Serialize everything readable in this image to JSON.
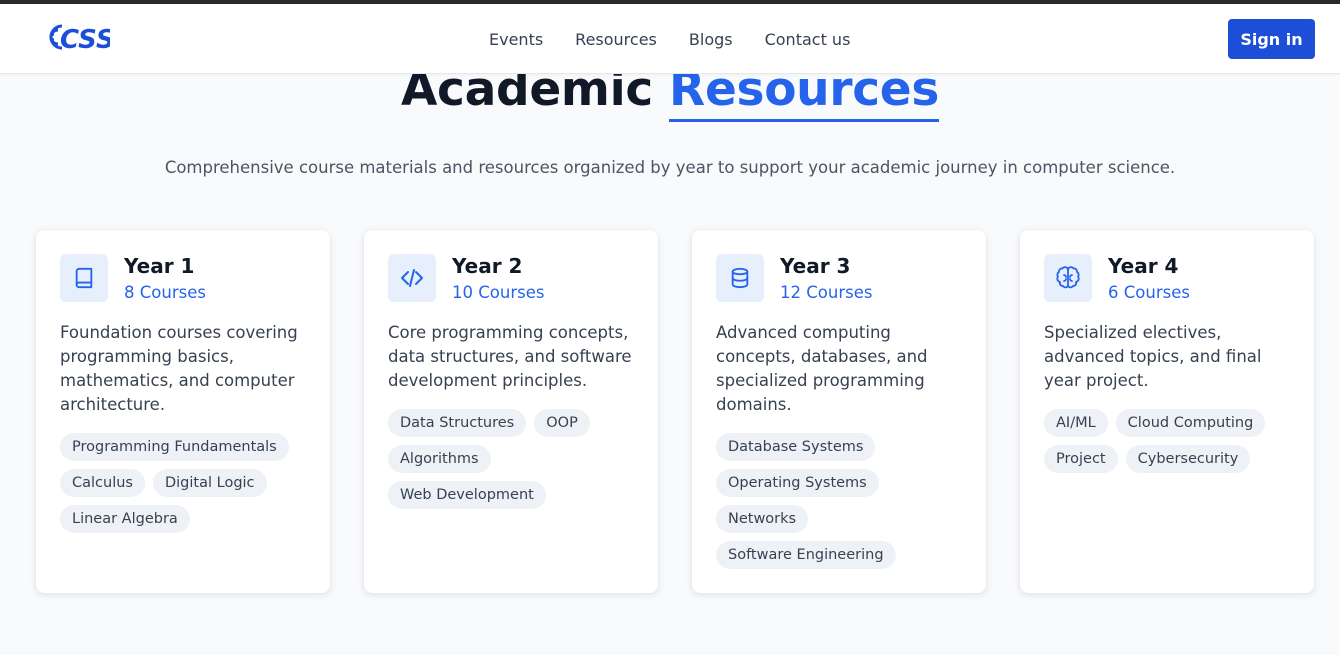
{
  "nav": {
    "logo_text": "CSS",
    "links": [
      "Events",
      "Resources",
      "Blogs",
      "Contact us"
    ],
    "signin_label": "Sign in"
  },
  "hero": {
    "title_main": "Academic",
    "title_accent": "Resources",
    "subtitle": "Comprehensive course materials and resources organized by year to support your academic journey in computer science."
  },
  "colors": {
    "accent": "#2563eb",
    "button": "#1d4ed8",
    "icon_bg": "#e8effc",
    "tag_bg": "#eef2f7"
  },
  "years": [
    {
      "title": "Year 1",
      "count": "8 Courses",
      "icon": "book-icon",
      "description": "Foundation courses covering programming basics, mathematics, and computer architecture.",
      "tags": [
        "Programming Fundamentals",
        "Calculus",
        "Digital Logic",
        "Linear Algebra"
      ]
    },
    {
      "title": "Year 2",
      "count": "10 Courses",
      "icon": "code-icon",
      "description": "Core programming concepts, data structures, and software development principles.",
      "tags": [
        "Data Structures",
        "OOP",
        "Algorithms",
        "Web Development"
      ]
    },
    {
      "title": "Year 3",
      "count": "12 Courses",
      "icon": "database-icon",
      "description": "Advanced computing concepts, databases, and specialized programming domains.",
      "tags": [
        "Database Systems",
        "Operating Systems",
        "Networks",
        "Software Engineering"
      ]
    },
    {
      "title": "Year 4",
      "count": "6 Courses",
      "icon": "brain-icon",
      "description": "Specialized electives, advanced topics, and final year project.",
      "tags": [
        "AI/ML",
        "Cloud Computing",
        "Project",
        "Cybersecurity"
      ]
    }
  ]
}
